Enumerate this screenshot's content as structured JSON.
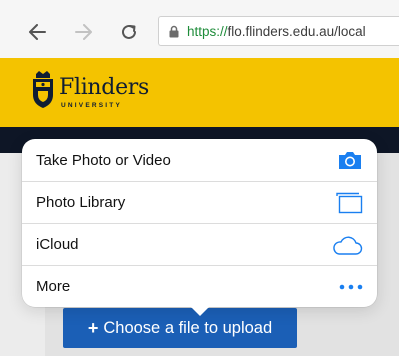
{
  "browser": {
    "url_scheme": "https://",
    "url_host": "flo.flinders.edu.au/local"
  },
  "brand": {
    "name": "Flinders",
    "subtitle": "UNIVERSITY",
    "color": "#f4c300"
  },
  "action_sheet": {
    "items": [
      {
        "label": "Take Photo or Video",
        "icon": "camera-icon"
      },
      {
        "label": "Photo Library",
        "icon": "photo-library-icon"
      },
      {
        "label": "iCloud",
        "icon": "icloud-icon"
      },
      {
        "label": "More",
        "icon": "more-icon"
      }
    ],
    "accent": "#1a7ff0"
  },
  "upload": {
    "plus": "+",
    "label": "Choose a file to upload",
    "color": "#1b5fb6"
  }
}
